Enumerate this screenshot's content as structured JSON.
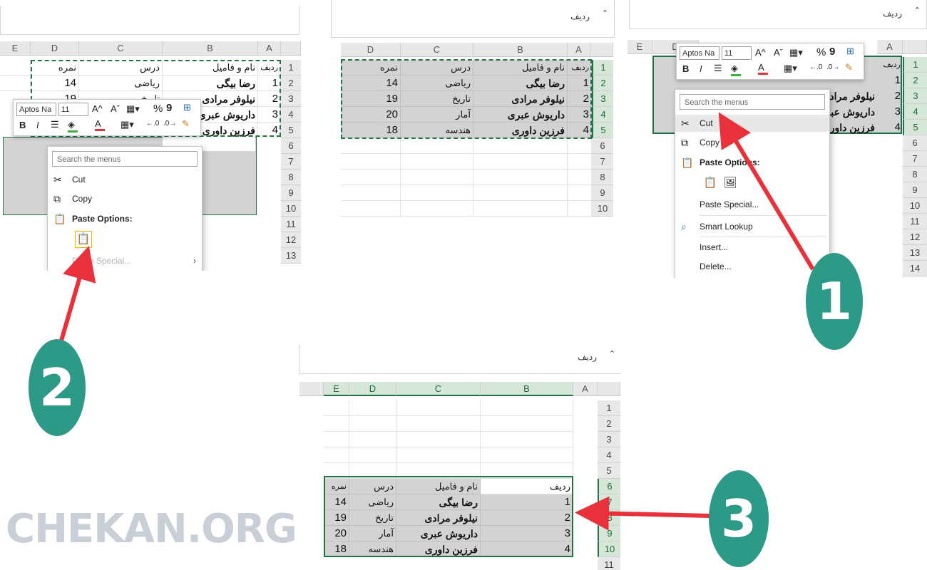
{
  "namebox_label": "ردیف",
  "columns": [
    "A",
    "B",
    "C",
    "D",
    "E"
  ],
  "table": {
    "headers": [
      "ردیف",
      "نام و فامیل",
      "درس",
      "نمره"
    ],
    "rows": [
      [
        "1",
        "رضا بیگی",
        "ریاضی",
        "14"
      ],
      [
        "2",
        "نیلوفر مرادی",
        "تاریخ",
        "19"
      ],
      [
        "3",
        "داریوش عبری",
        "آمار",
        "20"
      ],
      [
        "4",
        "فرزین داوری",
        "هندسه",
        "18"
      ]
    ]
  },
  "row_numbers": [
    "1",
    "2",
    "3",
    "4",
    "5",
    "6",
    "7",
    "8",
    "9",
    "10",
    "11",
    "12",
    "13",
    "14"
  ],
  "mini_toolbar": {
    "font_name": "Aptos Na",
    "font_size": "11",
    "bold": "B",
    "italic": "I",
    "increase_font": "A^",
    "decrease_font": "Aˇ",
    "percent": "%",
    "comma": "9"
  },
  "context_menu": {
    "search_placeholder": "Search the menus",
    "cut": "Cut",
    "copy": "Copy",
    "paste_options": "Paste Options:",
    "paste_special": "Paste Special...",
    "smart_lookup": "Smart Lookup",
    "insert": "Insert...",
    "delete": "Delete..."
  },
  "steps": [
    "1",
    "2",
    "3"
  ],
  "watermark": "CHEKAN.ORG",
  "colors": {
    "accent": "#217346",
    "badge": "#2c9a86",
    "arrow": "#e8313b"
  }
}
